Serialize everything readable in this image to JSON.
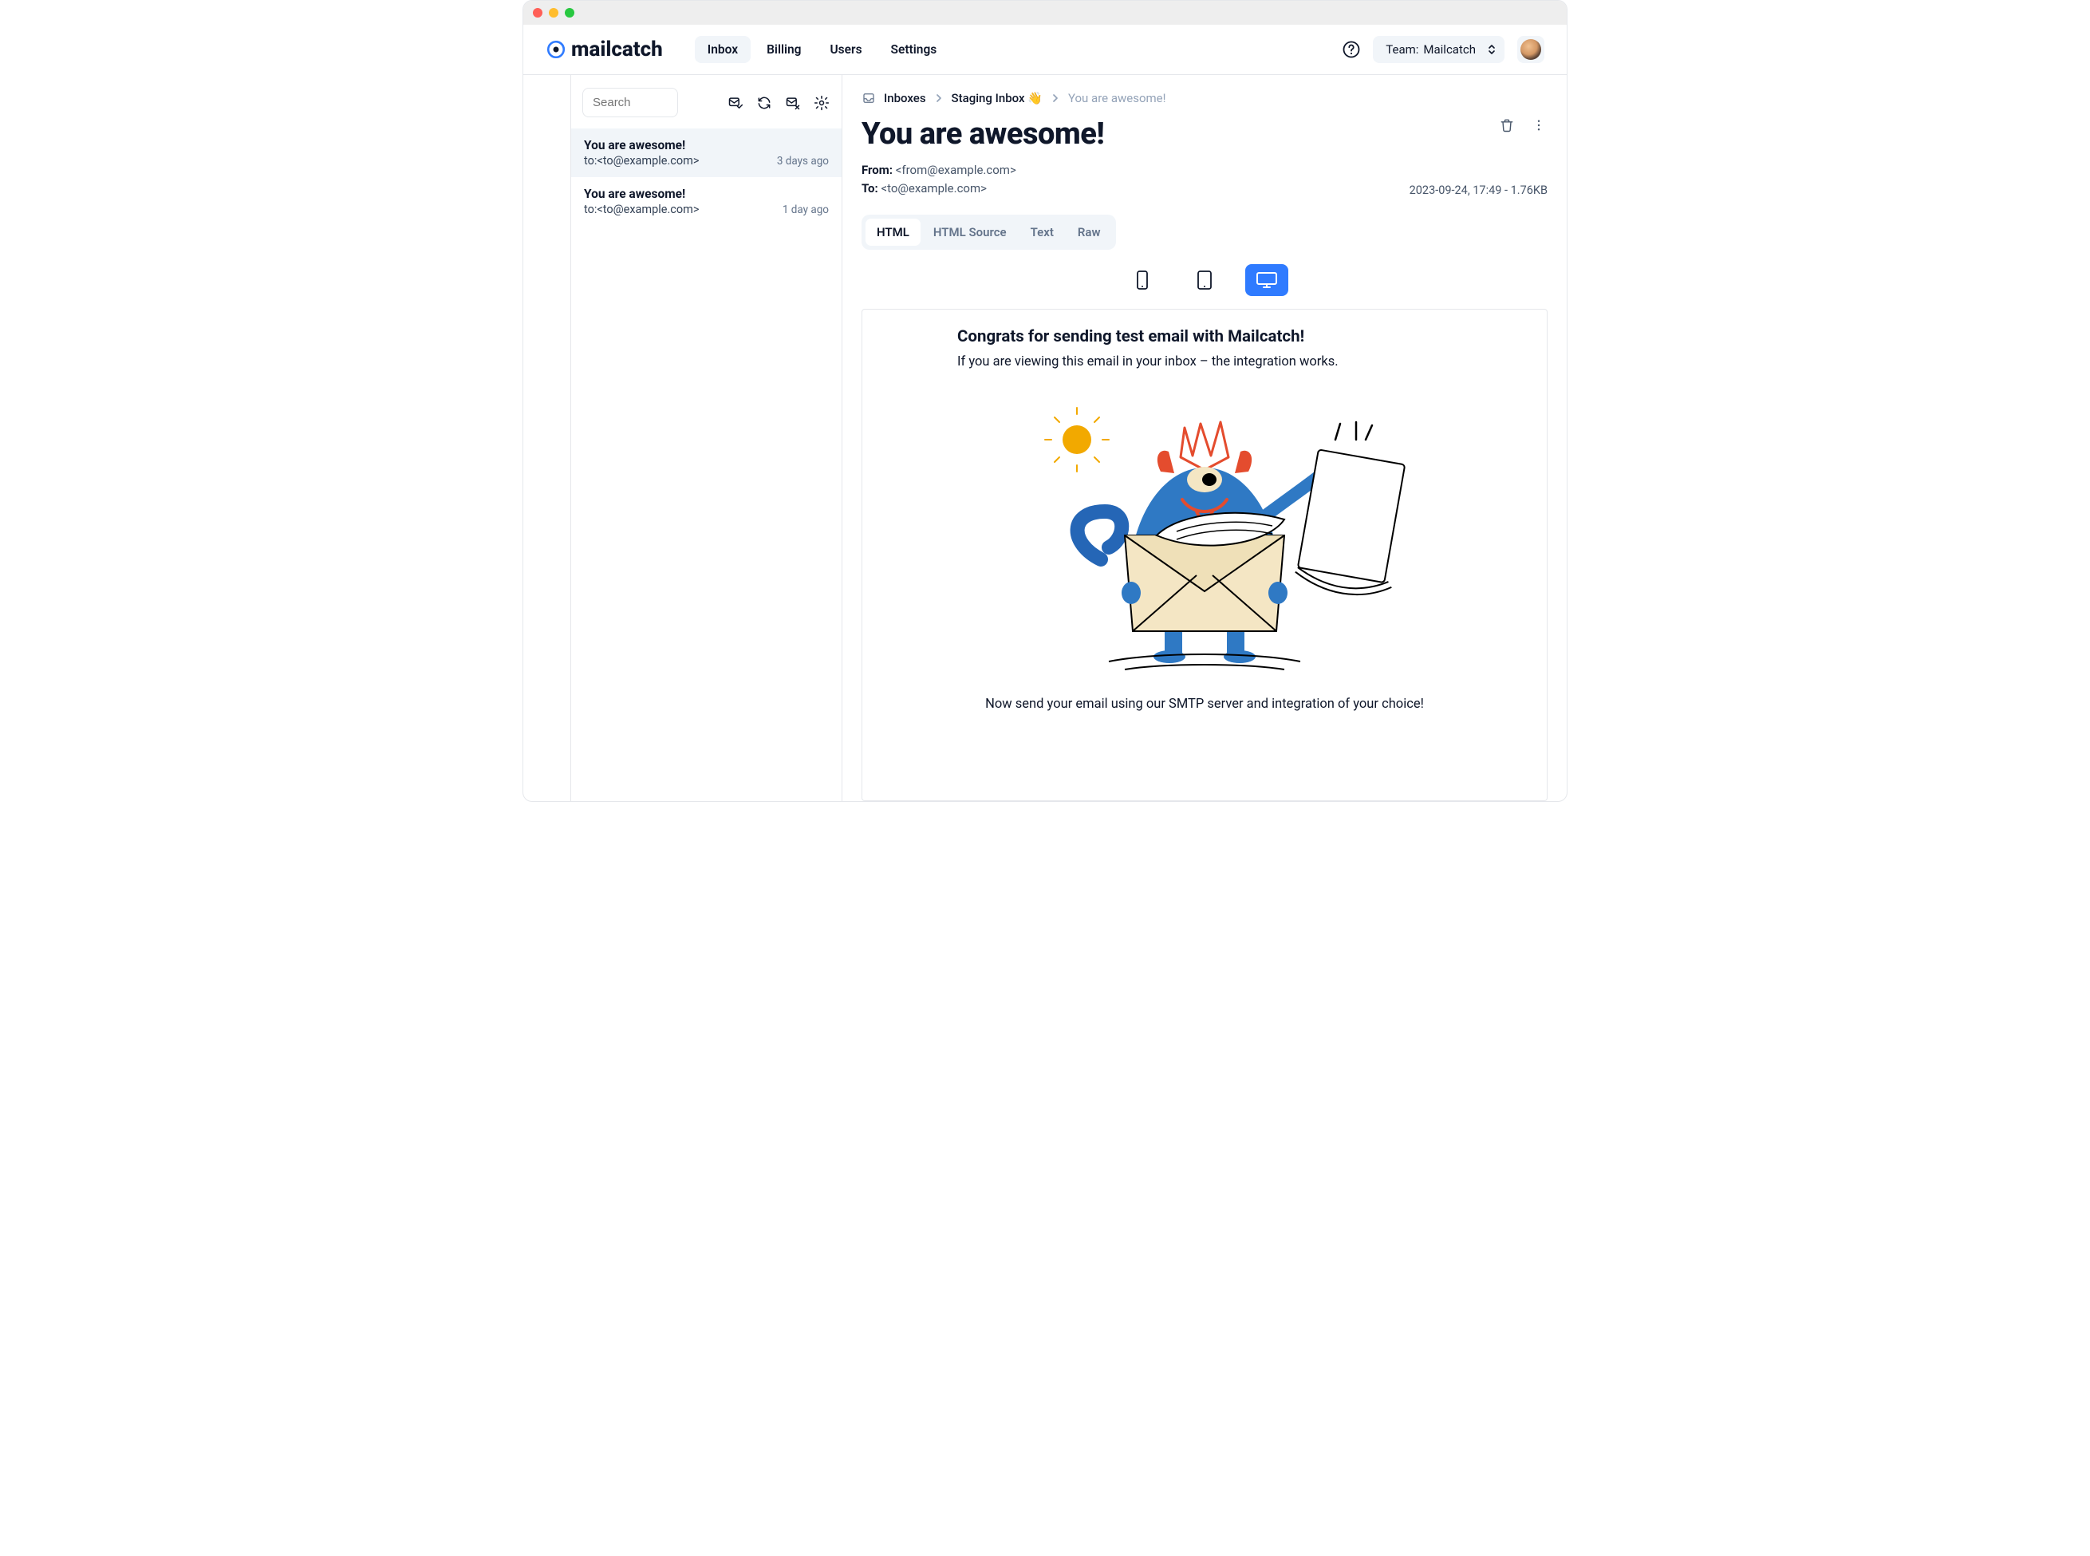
{
  "brand": {
    "name": "mailcatch"
  },
  "nav": {
    "items": [
      "Inbox",
      "Billing",
      "Users",
      "Settings"
    ],
    "active_index": 0
  },
  "team": {
    "label_prefix": "Team: ",
    "name": "Mailcatch"
  },
  "sidebar": {
    "search_placeholder": "Search",
    "messages": [
      {
        "subject": "You are awesome!",
        "to_line": "to:<to@example.com>",
        "time": "3 days ago",
        "active": true
      },
      {
        "subject": "You are awesome!",
        "to_line": "to:<to@example.com>",
        "time": "1 day ago",
        "active": false
      }
    ]
  },
  "breadcrumb": {
    "root": "Inboxes",
    "inbox": "Staging Inbox",
    "current": "You are awesome!"
  },
  "message": {
    "title": "You are awesome!",
    "from_label": "From:",
    "from_value": "<from@example.com>",
    "to_label": "To:",
    "to_value": "<to@example.com>",
    "meta": "2023-09-24, 17:49 - 1.76KB"
  },
  "viewTabs": {
    "items": [
      "HTML",
      "HTML Source",
      "Text",
      "Raw"
    ],
    "active_index": 0
  },
  "email": {
    "headline": "Congrats for sending test email with Mailcatch!",
    "sub": "If you are viewing this email in your inbox – the integration works.",
    "footer": "Now send your email using our SMTP server and integration of your choice!"
  },
  "colors": {
    "accent": "#2f7bff",
    "muted": "#64748b",
    "panel": "#f1f5f9",
    "border": "#e5e7eb"
  }
}
